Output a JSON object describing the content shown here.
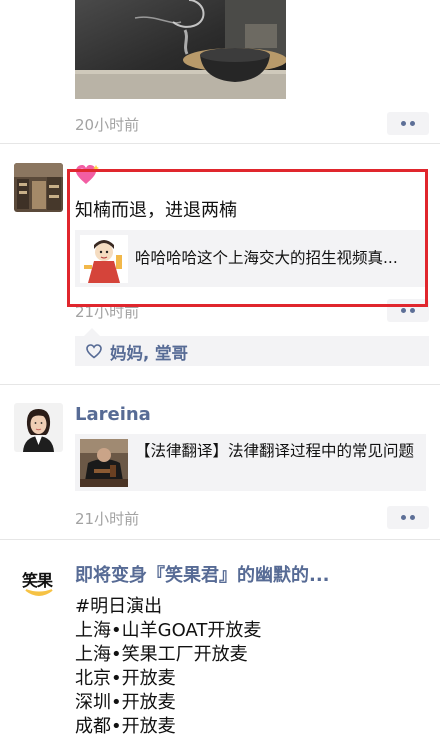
{
  "feed": {
    "post1": {
      "time": "20小时前"
    },
    "post2": {
      "text": "知楠而退，进退两楠",
      "link_title": "哈哈哈哈这个上海交大的招生视频真...",
      "time": "21小时前",
      "likes": "妈妈, 堂哥",
      "highlight_color": "#e0262d"
    },
    "post3": {
      "name": "Lareina",
      "link_title": "【法律翻译】法律翻译过程中的常见问题",
      "time": "21小时前"
    },
    "post4": {
      "name": "即将变身『笑果君』的幽默的...",
      "avatar_text": "笑果",
      "lines": [
        "#明日演出",
        "上海•山羊GOAT开放麦",
        "上海•笑果工厂开放麦",
        "北京•开放麦",
        "深圳•开放麦",
        "成都•开放麦"
      ]
    }
  },
  "colors": {
    "name": "#576b95",
    "time": "#a3a3a3",
    "card": "#f3f3f5",
    "logo_yellow": "#f6c244"
  }
}
